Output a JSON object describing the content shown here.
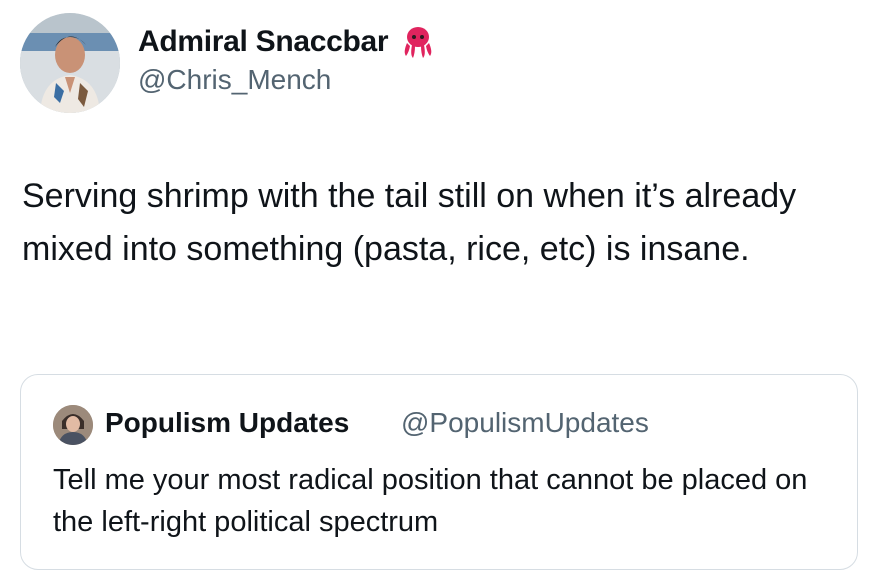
{
  "tweet": {
    "author": {
      "display_name": "Admiral Snaccbar",
      "name_emoji": "octopus",
      "handle": "@Chris_Mench",
      "avatar_icon": "user-avatar-photo"
    },
    "text": "Serving shrimp with the tail still on when it’s already mixed into something (pasta, rice, etc) is insane.",
    "quoted_tweet": {
      "author": {
        "display_name": "Populism Updates",
        "handle": "@PopulismUpdates",
        "avatar_icon": "user-avatar-photo"
      },
      "text": "Tell me your most radical position that cannot be placed on the left-right political spectrum"
    }
  },
  "colors": {
    "text_primary": "#0f1419",
    "text_secondary": "#536471",
    "card_border": "#d6dde3",
    "octopus_emoji": "#e0245e"
  }
}
